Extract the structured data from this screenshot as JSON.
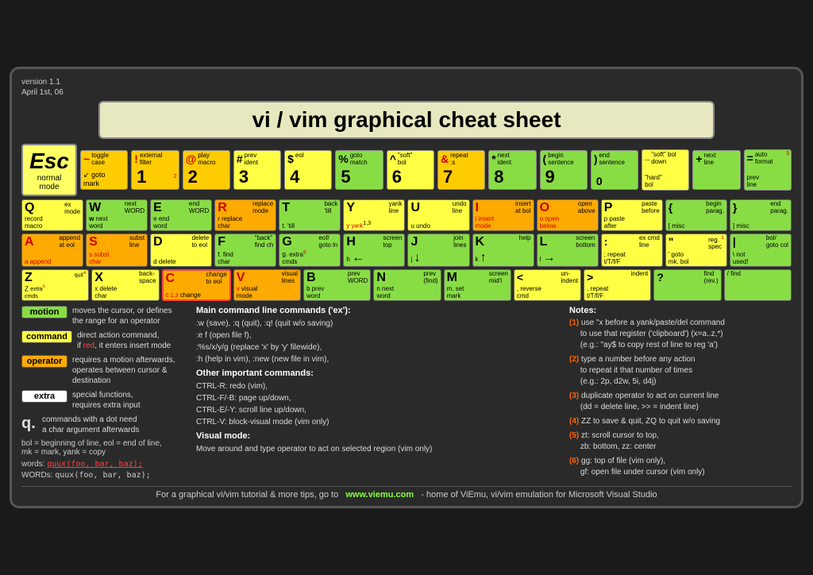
{
  "meta": {
    "version": "version 1.1",
    "date": "April 1st, 06"
  },
  "title": "vi / vim graphical cheat sheet",
  "footer": "For a graphical vi/vim tutorial & more tips, go to   www.viemu.com  - home of ViEmu, vi/vim emulation for Microsoft Visual Studio",
  "esc_key": {
    "label": "Esc",
    "sub": "normal\nmode"
  },
  "legend": {
    "motion": {
      "label": "motion",
      "desc": "moves the cursor, or defines\nthe range for an operator"
    },
    "command": {
      "label": "command",
      "desc": "direct action command,\nif red, it enters insert mode"
    },
    "operator": {
      "label": "operator",
      "desc": "requires a motion afterwards,\noperates between cursor &\ndestination"
    },
    "extra": {
      "label": "extra",
      "desc": "special functions,\nrequires extra input"
    },
    "qdot": {
      "desc": "commands with a dot need\na char argument afterwards"
    }
  },
  "bol_note": "bol = beginning of line, eol = end of line,\nmk = mark, yank = copy",
  "words_label": "words:",
  "words_example": "quux(foo, bar, baz);",
  "words_label2": "WORDs:",
  "words_example2": "quux(foo, bar, baz);",
  "main_commands": {
    "title": "Main command line commands ('ex'):",
    "lines": [
      ":w (save), :q (quit), :q! (quit w/o saving)",
      ":e f (open file f),",
      ":%s/x/y/g (replace 'x' by 'y' filewide),",
      ":h (help in vim), :new (new file in vim),"
    ],
    "other_title": "Other important commands:",
    "other_lines": [
      "CTRL-R: redo (vim),",
      "CTRL-F/-B: page up/down,",
      "CTRL-E/-Y: scroll line up/down,",
      "CTRL-V: block-visual mode (vim only)"
    ],
    "visual_title": "Visual mode:",
    "visual_text": "Move around and type operator to act\non selected region (vim only)"
  },
  "notes": {
    "title": "Notes:",
    "items": [
      {
        "num": "(1)",
        "text": "use \"x before a yank/paste/del command\n      to use that register ('clipboard') (x=a..z,*)\n      (e.g.: \"ay$ to copy rest of line to reg 'a')"
      },
      {
        "num": "(2)",
        "text": "type a number before any action\n      to repeat it that number of times\n      (e.g.: 2p, d2w, 5i, d4j)"
      },
      {
        "num": "(3)",
        "text": "duplicate operator to act on current line\n      (dd = delete line, >> = indent line)"
      },
      {
        "num": "(4)",
        "text": "ZZ to save & quit, ZQ to quit w/o saving"
      },
      {
        "num": "(5)",
        "text": "zt: scroll cursor to top,\n      zb: bottom, zz: center"
      },
      {
        "num": "(6)",
        "text": "gg: top of file (vim only),\n      gf: open file under cursor (vim only)"
      }
    ]
  }
}
